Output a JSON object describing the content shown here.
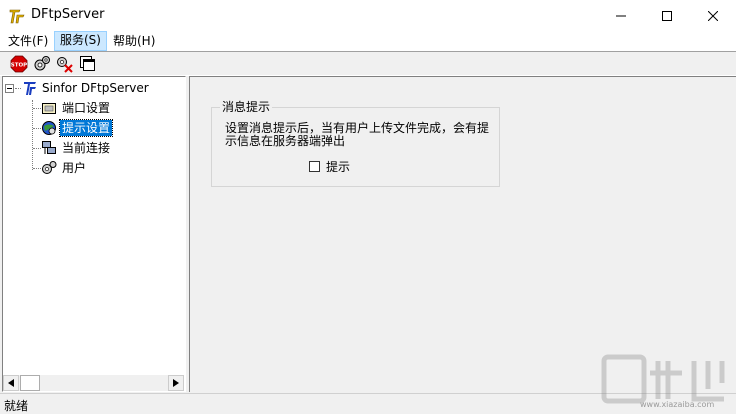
{
  "window": {
    "title": "DFtpServer"
  },
  "menu": [
    {
      "label": "文件(F)",
      "active": false
    },
    {
      "label": "服务(S)",
      "active": true
    },
    {
      "label": "帮助(H)",
      "active": false
    }
  ],
  "toolbar": {
    "icons": [
      "stop-icon",
      "config-icon",
      "disconnect-icon",
      "windows-icon"
    ]
  },
  "tree": {
    "root": "Sinfor DFtpServer",
    "items": [
      {
        "label": "端口设置",
        "icon": "port-settings-icon",
        "selected": false
      },
      {
        "label": "提示设置",
        "icon": "notify-settings-icon",
        "selected": true
      },
      {
        "label": "当前连接",
        "icon": "connections-icon",
        "selected": false
      },
      {
        "label": "用户",
        "icon": "users-icon",
        "selected": false
      }
    ]
  },
  "panel": {
    "group_title": "消息提示",
    "description": "设置消息提示后，当有用户上传文件完成，会有提示信息在服务器端弹出",
    "checkbox_label": "提示",
    "checkbox_checked": false
  },
  "status": {
    "text": "就绪"
  },
  "watermark": {
    "text": "下载吧",
    "url": "www.xiazaiba.com"
  },
  "colors": {
    "selection": "#0078d7",
    "menu_highlight": "#cce8ff"
  }
}
